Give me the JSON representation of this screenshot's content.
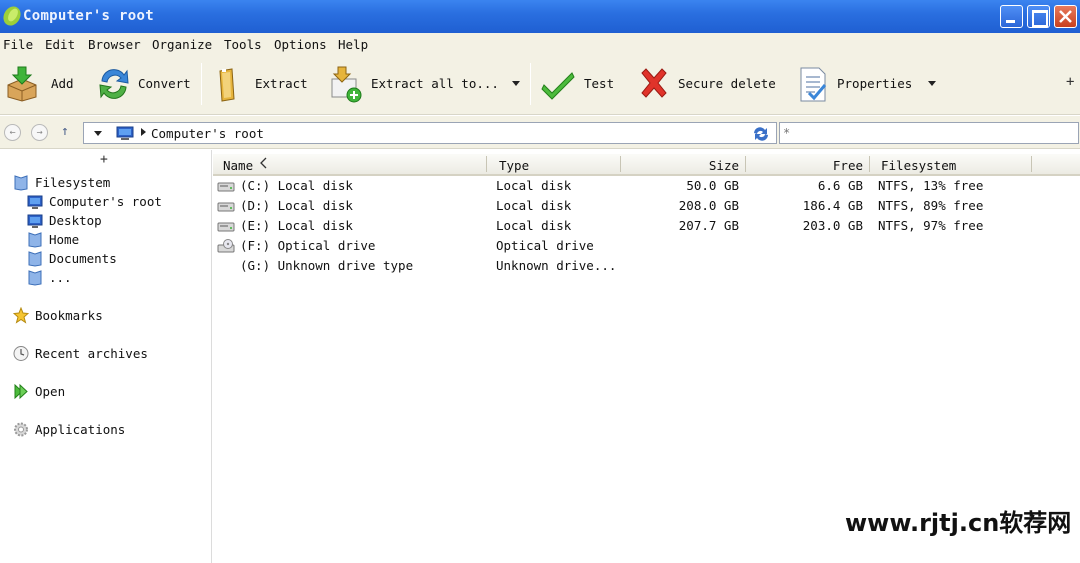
{
  "window": {
    "title": "Computer's root"
  },
  "menu": [
    "File",
    "Edit",
    "Browser",
    "Organize",
    "Tools",
    "Options",
    "Help"
  ],
  "toolbar": {
    "add": "Add",
    "convert": "Convert",
    "extract": "Extract",
    "extract_all": "Extract all to...",
    "test": "Test",
    "secure_delete": "Secure delete",
    "properties": "Properties",
    "more": "+"
  },
  "address": {
    "path": "Computer's root",
    "filter_placeholder": "*"
  },
  "sidebar": {
    "expand": "+",
    "filesystem": "Filesystem",
    "items": [
      "Computer's root",
      "Desktop",
      "Home",
      "Documents",
      "..."
    ],
    "bookmarks": "Bookmarks",
    "recent": "Recent archives",
    "open": "Open",
    "applications": "Applications"
  },
  "columns": {
    "name": "Name",
    "type": "Type",
    "size": "Size",
    "free": "Free",
    "filesystem": "Filesystem"
  },
  "rows": [
    {
      "name": "(C:) Local disk",
      "type": "Local disk",
      "size": "50.0 GB",
      "free": "6.6 GB",
      "fs": "NTFS, 13% free",
      "icon": "hard-disk"
    },
    {
      "name": "(D:) Local disk",
      "type": "Local disk",
      "size": "208.0 GB",
      "free": "186.4 GB",
      "fs": "NTFS, 89% free",
      "icon": "hard-disk"
    },
    {
      "name": "(E:) Local disk",
      "type": "Local disk",
      "size": "207.7 GB",
      "free": "203.0 GB",
      "fs": "NTFS, 97% free",
      "icon": "hard-disk"
    },
    {
      "name": "(F:) Optical drive",
      "type": "Optical drive",
      "size": "",
      "free": "",
      "fs": "",
      "icon": "optical-drive"
    },
    {
      "name": "(G:) Unknown drive type",
      "type": "Unknown drive...",
      "size": "",
      "free": "",
      "fs": "",
      "icon": "none"
    }
  ],
  "watermark": "www.rjtj.cn软荐网"
}
